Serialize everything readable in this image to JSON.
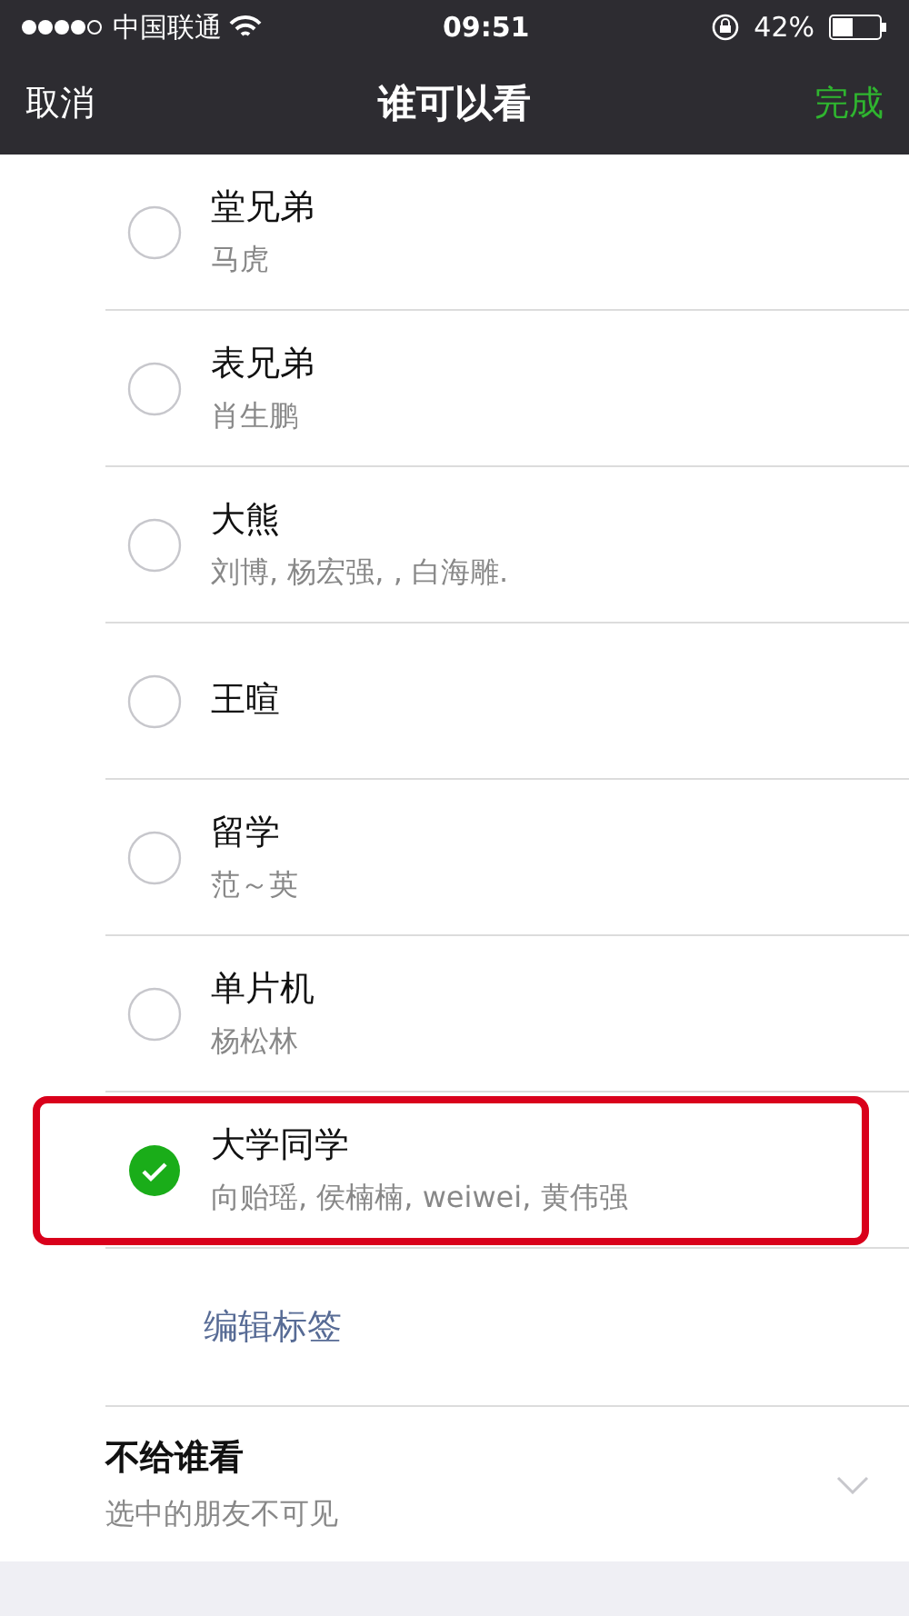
{
  "status_bar": {
    "carrier": "中国联通",
    "time": "09:51",
    "battery": "42%"
  },
  "nav": {
    "cancel": "取消",
    "title": "谁可以看",
    "done": "完成"
  },
  "groups": [
    {
      "name": "堂兄弟",
      "members": "马虎",
      "selected": false,
      "highlighted": false
    },
    {
      "name": "表兄弟",
      "members": "肖生鹏",
      "selected": false,
      "highlighted": false
    },
    {
      "name": "大熊",
      "members": "刘博, 杨宏强, , 白海雕.",
      "selected": false,
      "highlighted": false
    },
    {
      "name": "王暄",
      "selected": false,
      "highlighted": false
    },
    {
      "name": "留学",
      "members": "范～英",
      "selected": false,
      "highlighted": false
    },
    {
      "name": "单片机",
      "members": "杨松林",
      "selected": false,
      "highlighted": false
    },
    {
      "name": "大学同学",
      "members": "向贻瑶, 侯楠楠, weiwei, 黄伟强",
      "selected": true,
      "highlighted": true
    }
  ],
  "edit_tags": "编辑标签",
  "exclude": {
    "title": "不给谁看",
    "subtitle": "选中的朋友不可见",
    "expanded": false
  }
}
